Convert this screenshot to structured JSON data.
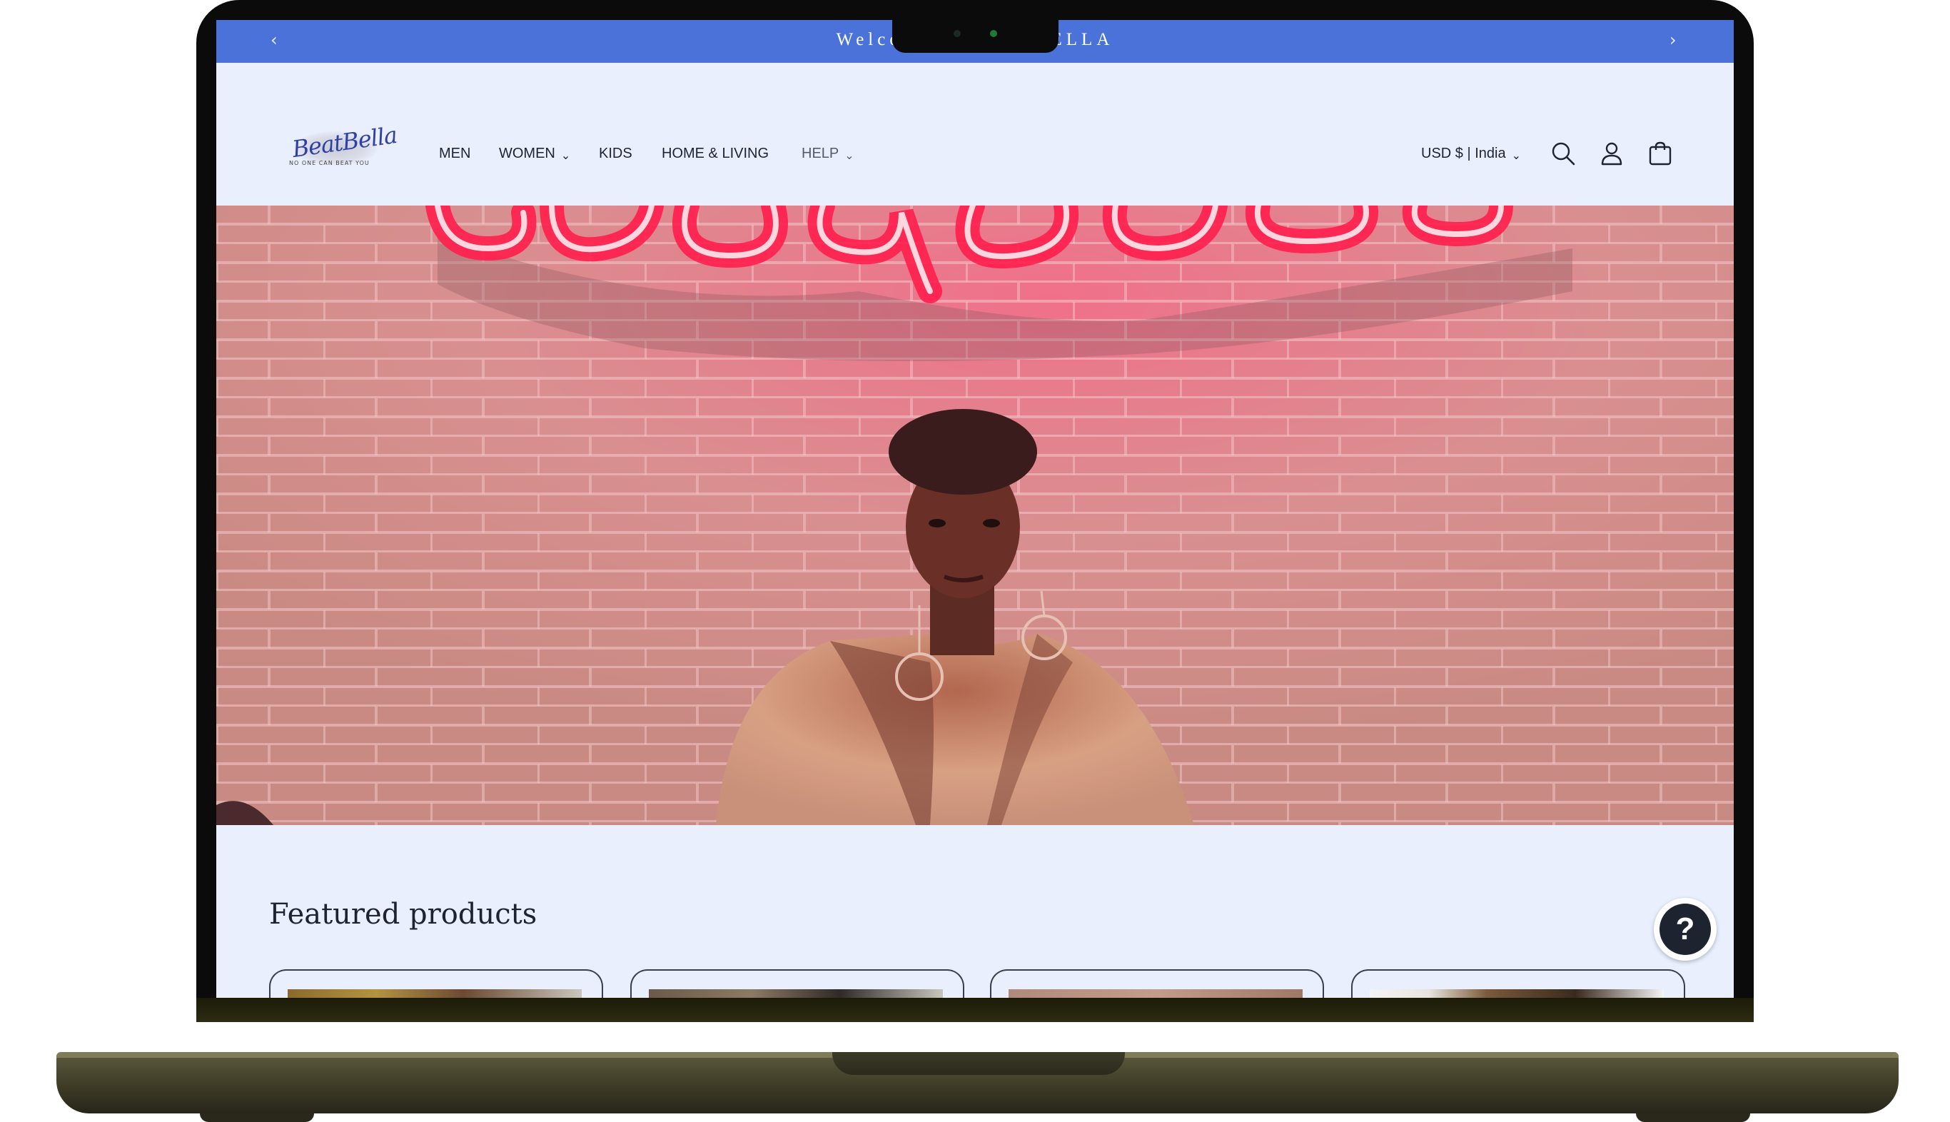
{
  "announcement": {
    "message": "Welcome to BEATBELLA",
    "prev_arrow": "‹",
    "next_arrow": "›"
  },
  "logo": {
    "script_text": "BeatBella",
    "tagline": "NO ONE CAN BEAT YOU"
  },
  "nav": {
    "items": [
      {
        "label": "MEN",
        "has_dropdown": false
      },
      {
        "label": "WOMEN",
        "has_dropdown": true
      },
      {
        "label": "KIDS",
        "has_dropdown": false
      },
      {
        "label": "HOME & LIVING",
        "has_dropdown": false
      },
      {
        "label": "HELP",
        "has_dropdown": true
      }
    ],
    "caret": "⌄"
  },
  "header_tools": {
    "currency": "USD $ | India",
    "icons": [
      "search-icon",
      "account-icon",
      "cart-icon"
    ]
  },
  "hero": {
    "image": "woman in fur coat in front of pink brick wall with neon sign"
  },
  "featured": {
    "heading": "Featured products",
    "card_count": 4
  },
  "help_widget": {
    "symbol": "?"
  },
  "colors": {
    "announcement_bg": "#4a72d9",
    "page_bg": "#e9effd",
    "text": "#1e2333",
    "neon": "#ff2d55"
  }
}
